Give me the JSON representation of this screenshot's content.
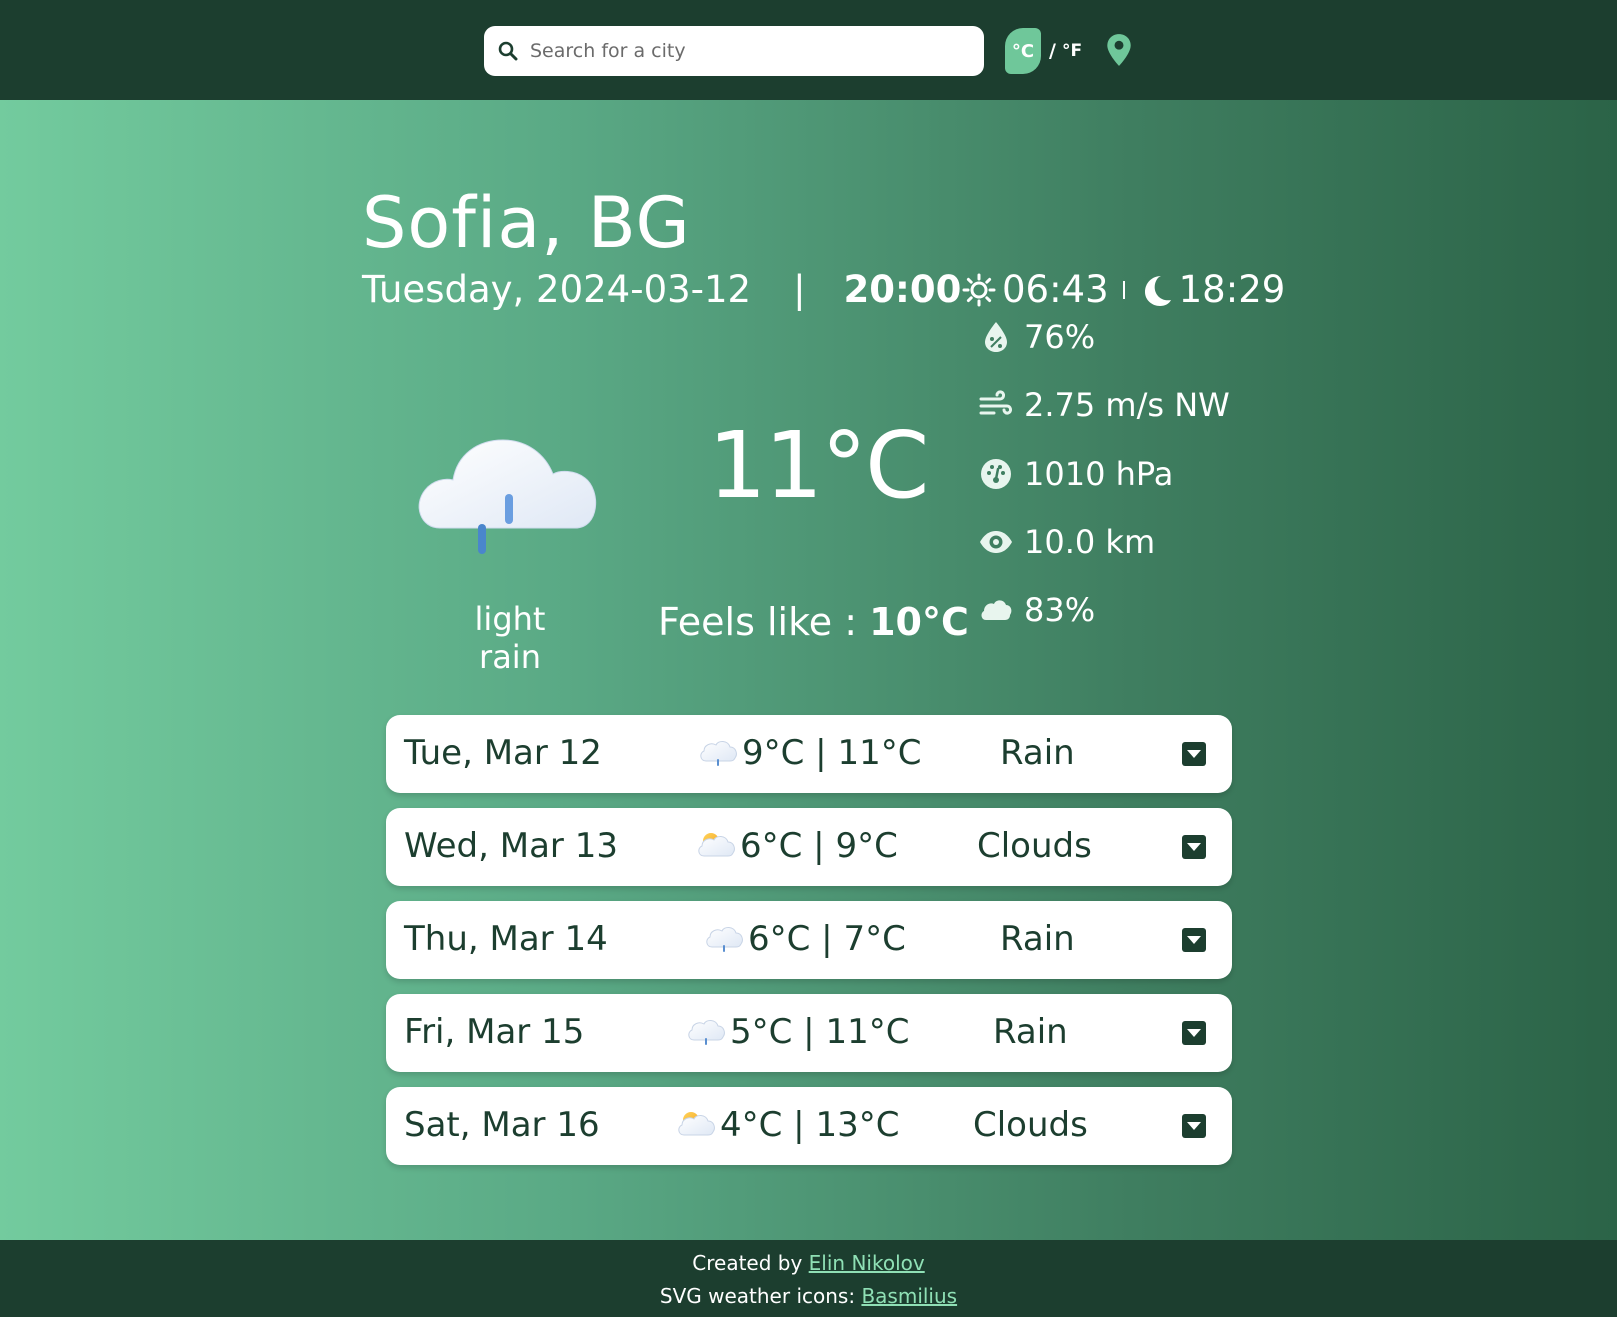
{
  "header": {
    "search_placeholder": "Search for a city",
    "unit_celsius": "°C",
    "unit_separator": "/",
    "unit_fahrenheit": "°F"
  },
  "current": {
    "city": "Sofia, BG",
    "date": "Tuesday, 2024-03-12",
    "separator": "|",
    "time": "20:00",
    "sunrise": "06:43",
    "sunset": "18:29",
    "temperature": "11°C",
    "description": "light rain",
    "feels_like_label": "Feels like : ",
    "feels_like_value": "10°C",
    "icon": "cloud-rain-icon"
  },
  "details": [
    {
      "icon": "humidity-icon",
      "value": "76%"
    },
    {
      "icon": "wind-icon",
      "value": "2.75 m/s NW"
    },
    {
      "icon": "pressure-icon",
      "value": "1010 hPa"
    },
    {
      "icon": "visibility-icon",
      "value": "10.0 km"
    },
    {
      "icon": "cloudiness-icon",
      "value": "83%"
    }
  ],
  "forecast": [
    {
      "day": "Tue, Mar 12",
      "temps": "9°C | 11°C",
      "condition": "Rain",
      "icon": "cloud-rain-icon"
    },
    {
      "day": "Wed, Mar 13",
      "temps": "6°C | 9°C",
      "condition": "Clouds",
      "icon": "partly-cloudy-icon"
    },
    {
      "day": "Thu, Mar 14",
      "temps": "6°C | 7°C",
      "condition": "Rain",
      "icon": "cloud-rain-icon"
    },
    {
      "day": "Fri, Mar 15",
      "temps": "5°C | 11°C",
      "condition": "Rain",
      "icon": "cloud-rain-icon"
    },
    {
      "day": "Sat, Mar 16",
      "temps": "4°C | 13°C",
      "condition": "Clouds",
      "icon": "partly-cloudy-icon"
    }
  ],
  "footer": {
    "created_by": "Created by ",
    "author": "Elin Nikolov",
    "icons_credit": "SVG weather icons: ",
    "icons_author": "Basmilius"
  },
  "colors": {
    "dark_green": "#1c3e2f",
    "accent": "#6fc79a",
    "link": "#8fe0b5"
  }
}
